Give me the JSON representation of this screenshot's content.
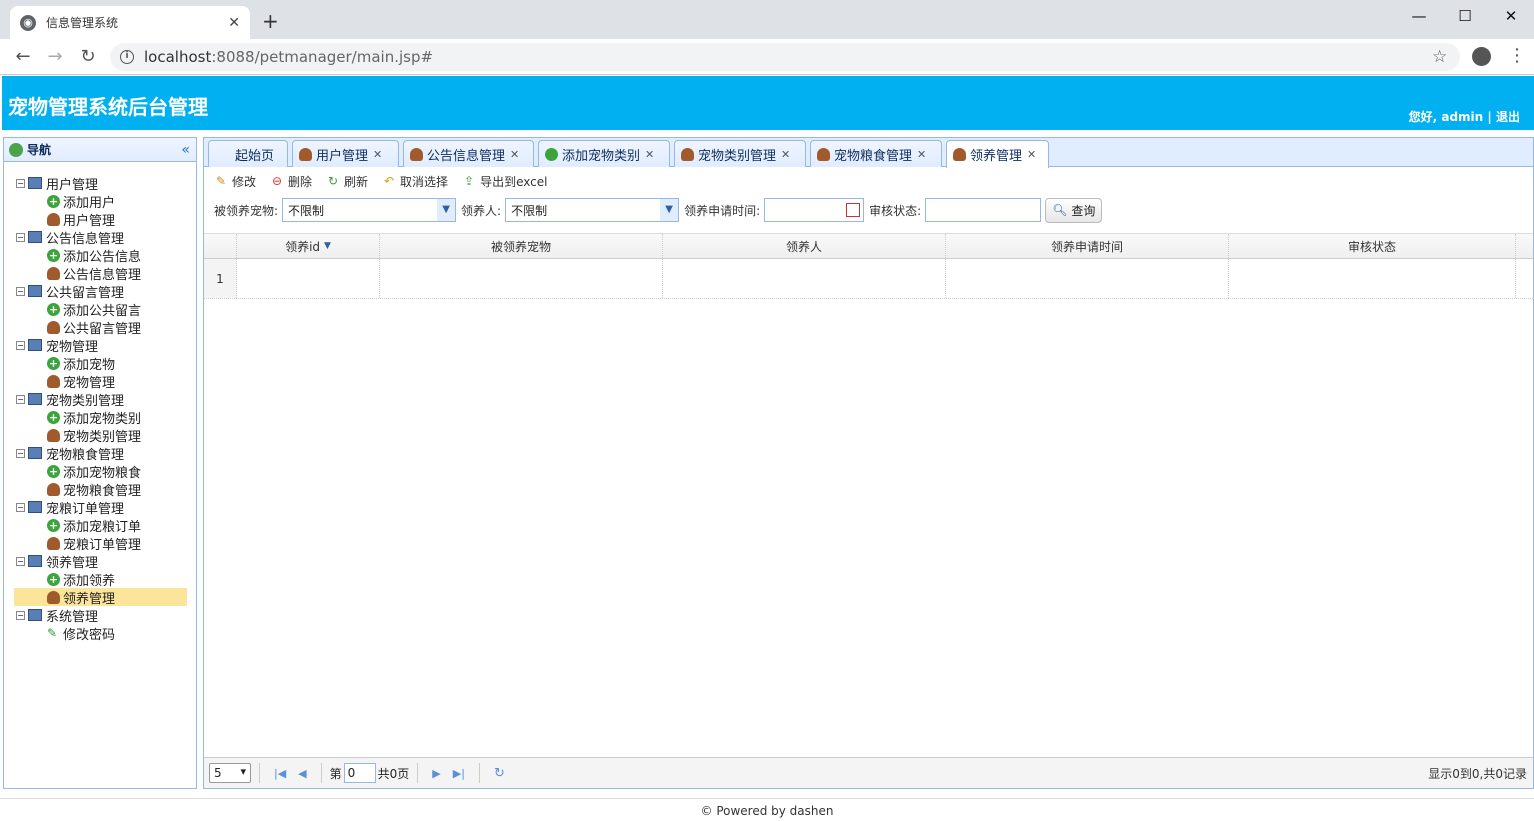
{
  "browser": {
    "tab_title": "信息管理系统",
    "url_host": "localhost",
    "url_rest": ":8088/petmanager/main.jsp#"
  },
  "header": {
    "title": "宠物管理系统后台管理",
    "greeting": "您好,",
    "username": "admin",
    "separator": "|",
    "logout": "退出"
  },
  "nav": {
    "title": "导航",
    "groups": [
      {
        "label": "用户管理",
        "items": [
          "添加用户",
          "用户管理"
        ]
      },
      {
        "label": "公告信息管理",
        "items": [
          "添加公告信息",
          "公告信息管理"
        ]
      },
      {
        "label": "公共留言管理",
        "items": [
          "添加公共留言",
          "公共留言管理"
        ]
      },
      {
        "label": "宠物管理",
        "items": [
          "添加宠物",
          "宠物管理"
        ]
      },
      {
        "label": "宠物类别管理",
        "items": [
          "添加宠物类别",
          "宠物类别管理"
        ]
      },
      {
        "label": "宠物粮食管理",
        "items": [
          "添加宠物粮食",
          "宠物粮食管理"
        ]
      },
      {
        "label": "宠粮订单管理",
        "items": [
          "添加宠粮订单",
          "宠粮订单管理"
        ]
      },
      {
        "label": "领养管理",
        "items": [
          "添加领养",
          "领养管理"
        ]
      },
      {
        "label": "系统管理",
        "items": [
          "修改密码"
        ]
      }
    ]
  },
  "tabs": [
    "起始页",
    "用户管理",
    "公告信息管理",
    "添加宠物类别",
    "宠物类别管理",
    "宠物粮食管理",
    "领养管理"
  ],
  "toolbar": {
    "edit": "修改",
    "delete": "删除",
    "refresh": "刷新",
    "cancel_select": "取消选择",
    "export": "导出到excel"
  },
  "search": {
    "pet_label": "被领养宠物:",
    "pet_value": "不限制",
    "adopter_label": "领养人:",
    "adopter_value": "不限制",
    "apply_time_label": "领养申请时间:",
    "status_label": "审核状态:",
    "query_button": "查询"
  },
  "grid": {
    "columns": [
      "领养id",
      "被领养宠物",
      "领养人",
      "领养申请时间",
      "审核状态"
    ],
    "row_number": "1"
  },
  "pager": {
    "page_size": "5",
    "page_prefix": "第",
    "page_value": "0",
    "page_total": "共0页",
    "info": "显示0到0,共0记录"
  },
  "footer": "© Powered by dashen"
}
